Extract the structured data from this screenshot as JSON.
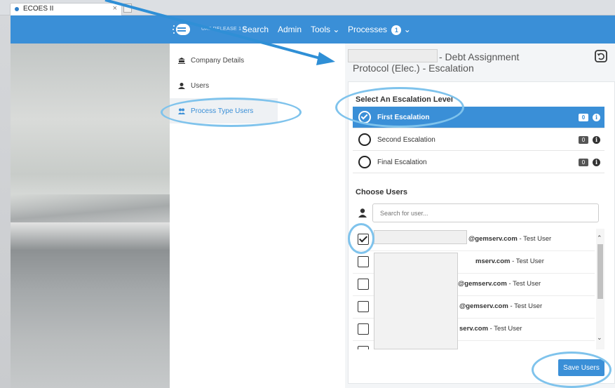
{
  "browser": {
    "tab_title": "ECOES II",
    "tab_close": "×"
  },
  "topnav": {
    "env_label": "UAT RELEASE 1.0",
    "items": [
      {
        "label": "Search"
      },
      {
        "label": "Admin"
      },
      {
        "label": "Tools ⌄"
      },
      {
        "label": "Processes"
      }
    ],
    "processes_badge": "1",
    "processes_caret": "⌄"
  },
  "sidebar": {
    "items": [
      {
        "label": "Company Details"
      },
      {
        "label": "Users"
      },
      {
        "label": "Process Type Users"
      }
    ]
  },
  "page": {
    "title_line1": "- Debt Assignment",
    "title_line2": "Protocol (Elec.) - Escalation"
  },
  "escalation": {
    "title": "Select An Escalation Level",
    "levels": [
      {
        "label": "First Escalation",
        "count": "0",
        "selected": true
      },
      {
        "label": "Second Escalation",
        "count": "0",
        "selected": false
      },
      {
        "label": "Final Escalation",
        "count": "0",
        "selected": false
      }
    ],
    "info_glyph": "i"
  },
  "users": {
    "title": "Choose Users",
    "search_placeholder": "Search for user...",
    "rows": [
      {
        "email_domain": "@gemserv.com",
        "suffix": " - Test User",
        "checked": true
      },
      {
        "email_domain": "mserv.com",
        "suffix": " - Test User",
        "checked": false
      },
      {
        "email_domain": "@gemserv.com",
        "suffix": " - Test User",
        "checked": false
      },
      {
        "email_domain": "@gemserv.com",
        "suffix": " - Test User",
        "checked": false
      },
      {
        "email_domain": "serv.com",
        "suffix": " - Test User",
        "checked": false
      },
      {
        "email_domain": "",
        "suffix": "",
        "checked": false
      }
    ],
    "save_label": "Save Users"
  },
  "colors": {
    "brand": "#3a8fd7",
    "annotation": "#7fc3ec"
  }
}
